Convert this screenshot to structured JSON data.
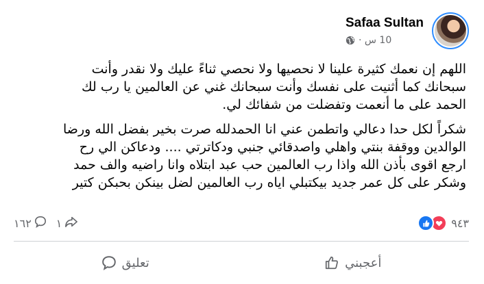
{
  "post": {
    "author": "Safaa Sultan",
    "time": "10 س ·",
    "paragraphs": [
      {
        "lines": [
          "اللهم إن نعمك كثيرة علينا لا نحصيها ولا نحصي ثناءً عليك ولا نقدر وأنت",
          "سبحانك كما أثنيت على نفسك وأنت سبحانك غني عن العالمين يا رب لك",
          "الحمد على ما أنعمت وتفضلت من شفائك لي."
        ]
      },
      {
        "lines": [
          "شكراً لكل حدا دعالي واتطمن عني انا الحمدلله صرت بخير بفضل الله ورضا",
          "الوالدين ووقفة بنتي واهلي واصدقائي جنبي ودكاترتي .... ودعاكن الي رح",
          "ارجع اقوى بأذن الله واذا رب العالمين حب عبد ابتلاه وانا راضيه والف حمد",
          "وشكر على كل عمر جديد بيكتبلي اياه رب العالمين لضل بينكن بحبكن كتير"
        ]
      }
    ]
  },
  "stats": {
    "reactions_count": "٩٤٣",
    "comments_count": "١٦٢",
    "shares_count": "١"
  },
  "actions": {
    "like_label": "أعجبني",
    "comment_label": "تعليق"
  },
  "icons": {
    "globe": "globe-icon",
    "like_reaction": "like-reaction-icon",
    "love_reaction": "love-reaction-icon",
    "comment": "comment-icon",
    "share": "share-icon",
    "thumbs_up": "thumbs-up-icon"
  },
  "colors": {
    "like_blue": "#1877f2",
    "love_red": "#f33e58",
    "secondary_text": "#65676b",
    "avatar_ring": "#2d8cff"
  }
}
